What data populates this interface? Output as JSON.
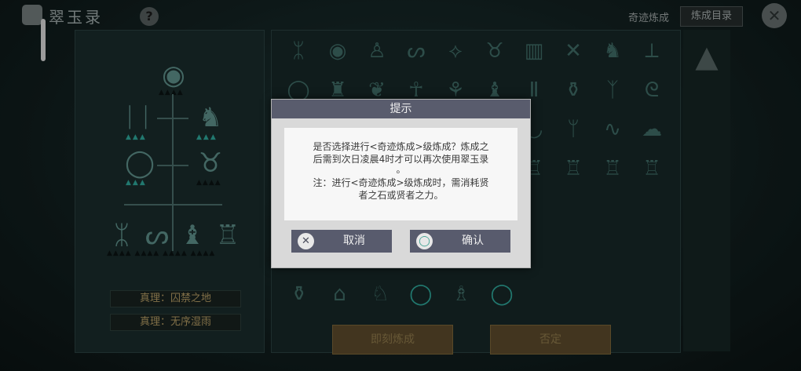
{
  "header": {
    "app_title": "翠玉录",
    "help_glyph": "?",
    "miracle_label": "奇迹炼成",
    "catalog_button": "炼成目录",
    "close_icon": "✕"
  },
  "left_panel": {
    "truths": [
      "真理：囚禁之地",
      "真理：无序湿雨"
    ]
  },
  "bottom_buttons": {
    "immediate": "即刻炼成",
    "deny": "否定"
  },
  "dialog": {
    "title": "提示",
    "message_lines": [
      "是否选择进行<奇迹炼成>级炼成？炼成之",
      "后需到次日凌晨4时才可以再次使用翠玉录",
      "。",
      "注：进行<奇迹炼成>级炼成时，需消耗贤",
      "者之石或贤者之力。"
    ],
    "cancel_label": "取消",
    "confirm_label": "确认"
  },
  "colors": {
    "dialog_header": "#595c6d",
    "dialog_button": "#585b6d",
    "bottom_button": "#5c4a2c",
    "truth_text": "#b49b64"
  }
}
